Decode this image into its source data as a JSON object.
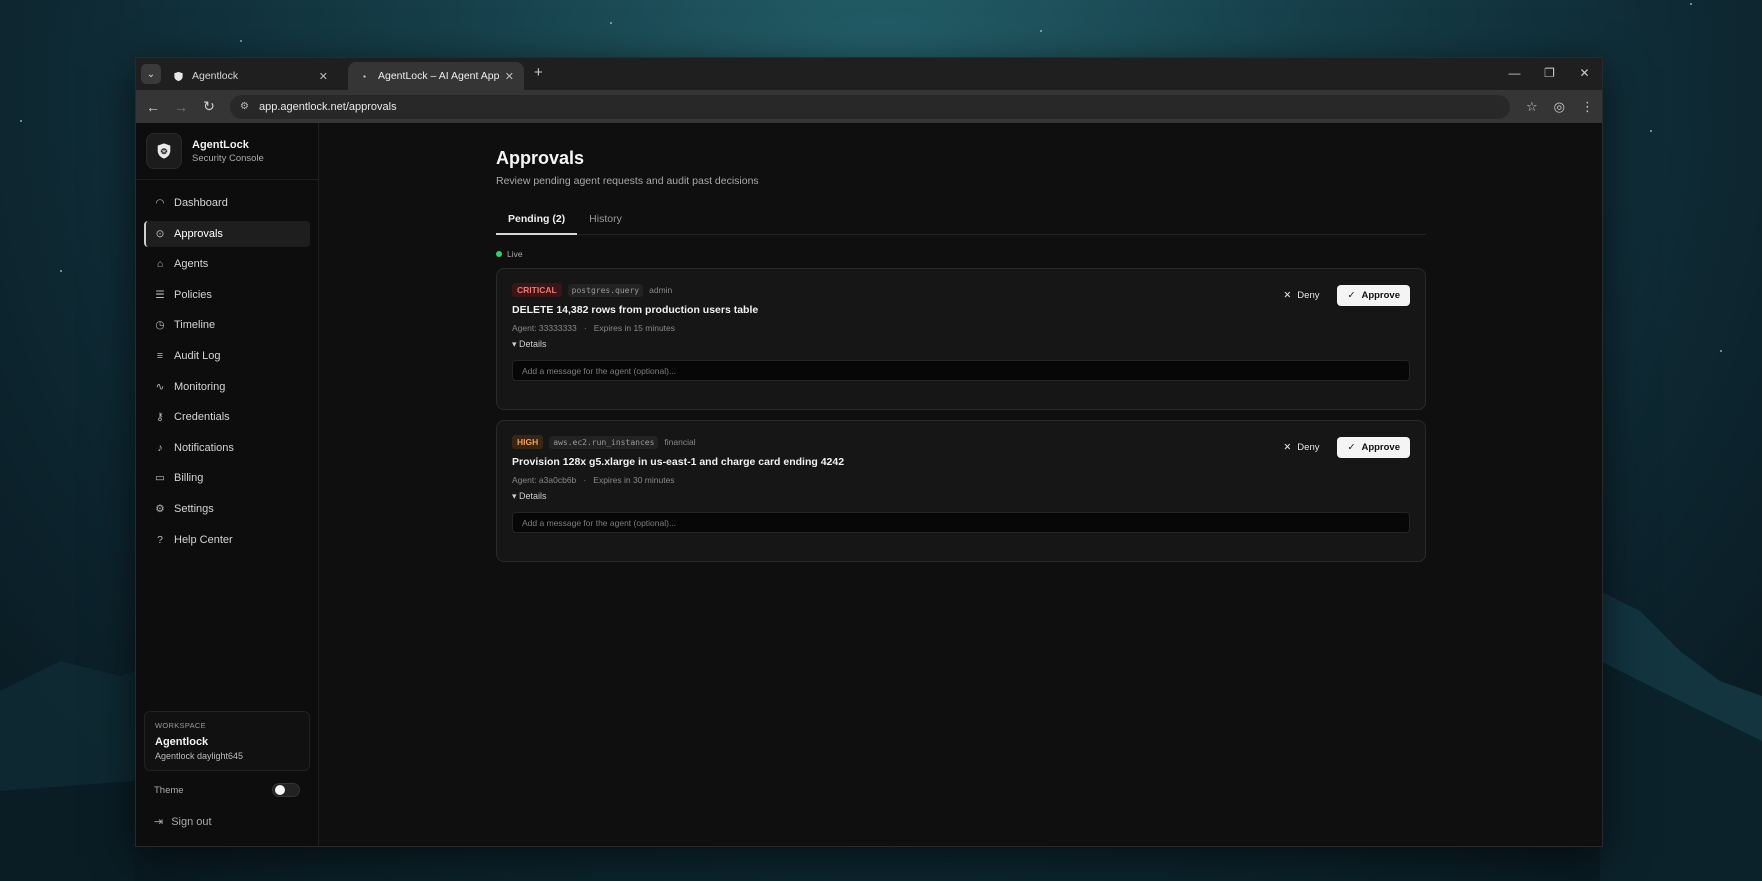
{
  "browser": {
    "tabs": [
      {
        "title": "Agentlock"
      },
      {
        "title": "AgentLock – AI Agent Approval"
      }
    ],
    "url": "app.agentlock.net/approvals"
  },
  "sidebar": {
    "brand_name": "AgentLock",
    "brand_sub": "Security Console",
    "items": [
      {
        "label": "Dashboard",
        "icon": "gauge-icon"
      },
      {
        "label": "Approvals",
        "icon": "check-circle-icon"
      },
      {
        "label": "Agents",
        "icon": "robot-icon"
      },
      {
        "label": "Policies",
        "icon": "sliders-icon"
      },
      {
        "label": "Timeline",
        "icon": "clock-icon"
      },
      {
        "label": "Audit Log",
        "icon": "list-icon"
      },
      {
        "label": "Monitoring",
        "icon": "activity-icon"
      },
      {
        "label": "Credentials",
        "icon": "key-icon"
      },
      {
        "label": "Notifications",
        "icon": "bell-icon"
      },
      {
        "label": "Billing",
        "icon": "card-icon"
      },
      {
        "label": "Settings",
        "icon": "gear-icon"
      },
      {
        "label": "Help Center",
        "icon": "help-icon"
      }
    ],
    "active_index": 1,
    "workspace_label": "WORKSPACE",
    "workspace_name": "Agentlock",
    "workspace_sub": "Agentlock daylight645",
    "theme_label": "Theme",
    "signout_label": "Sign out"
  },
  "page": {
    "title": "Approvals",
    "subtitle": "Review pending agent requests and audit past decisions",
    "tabs": [
      {
        "label": "Pending (2)"
      },
      {
        "label": "History"
      }
    ],
    "live_label": "Live"
  },
  "requests": [
    {
      "severity": "CRITICAL",
      "tool": "postgres.query",
      "category": "admin",
      "title": "DELETE 14,382 rows from production users table",
      "agent": "Agent: 33333333",
      "expires": "Expires in 15 minutes",
      "details_label": "▾ Details",
      "placeholder": "Add a message for the agent (optional)...",
      "deny_label": "Deny",
      "approve_label": "Approve"
    },
    {
      "severity": "HIGH",
      "tool": "aws.ec2.run_instances",
      "category": "financial",
      "title": "Provision 128x g5.xlarge in us-east-1 and charge card ending 4242",
      "agent": "Agent: a3a0cb6b",
      "expires": "Expires in 30 minutes",
      "details_label": "▾ Details",
      "placeholder": "Add a message for the agent (optional)...",
      "deny_label": "Deny",
      "approve_label": "Approve"
    }
  ],
  "colors": {
    "critical": "#f37575",
    "high": "#f0a050",
    "live": "#2fd06b"
  }
}
